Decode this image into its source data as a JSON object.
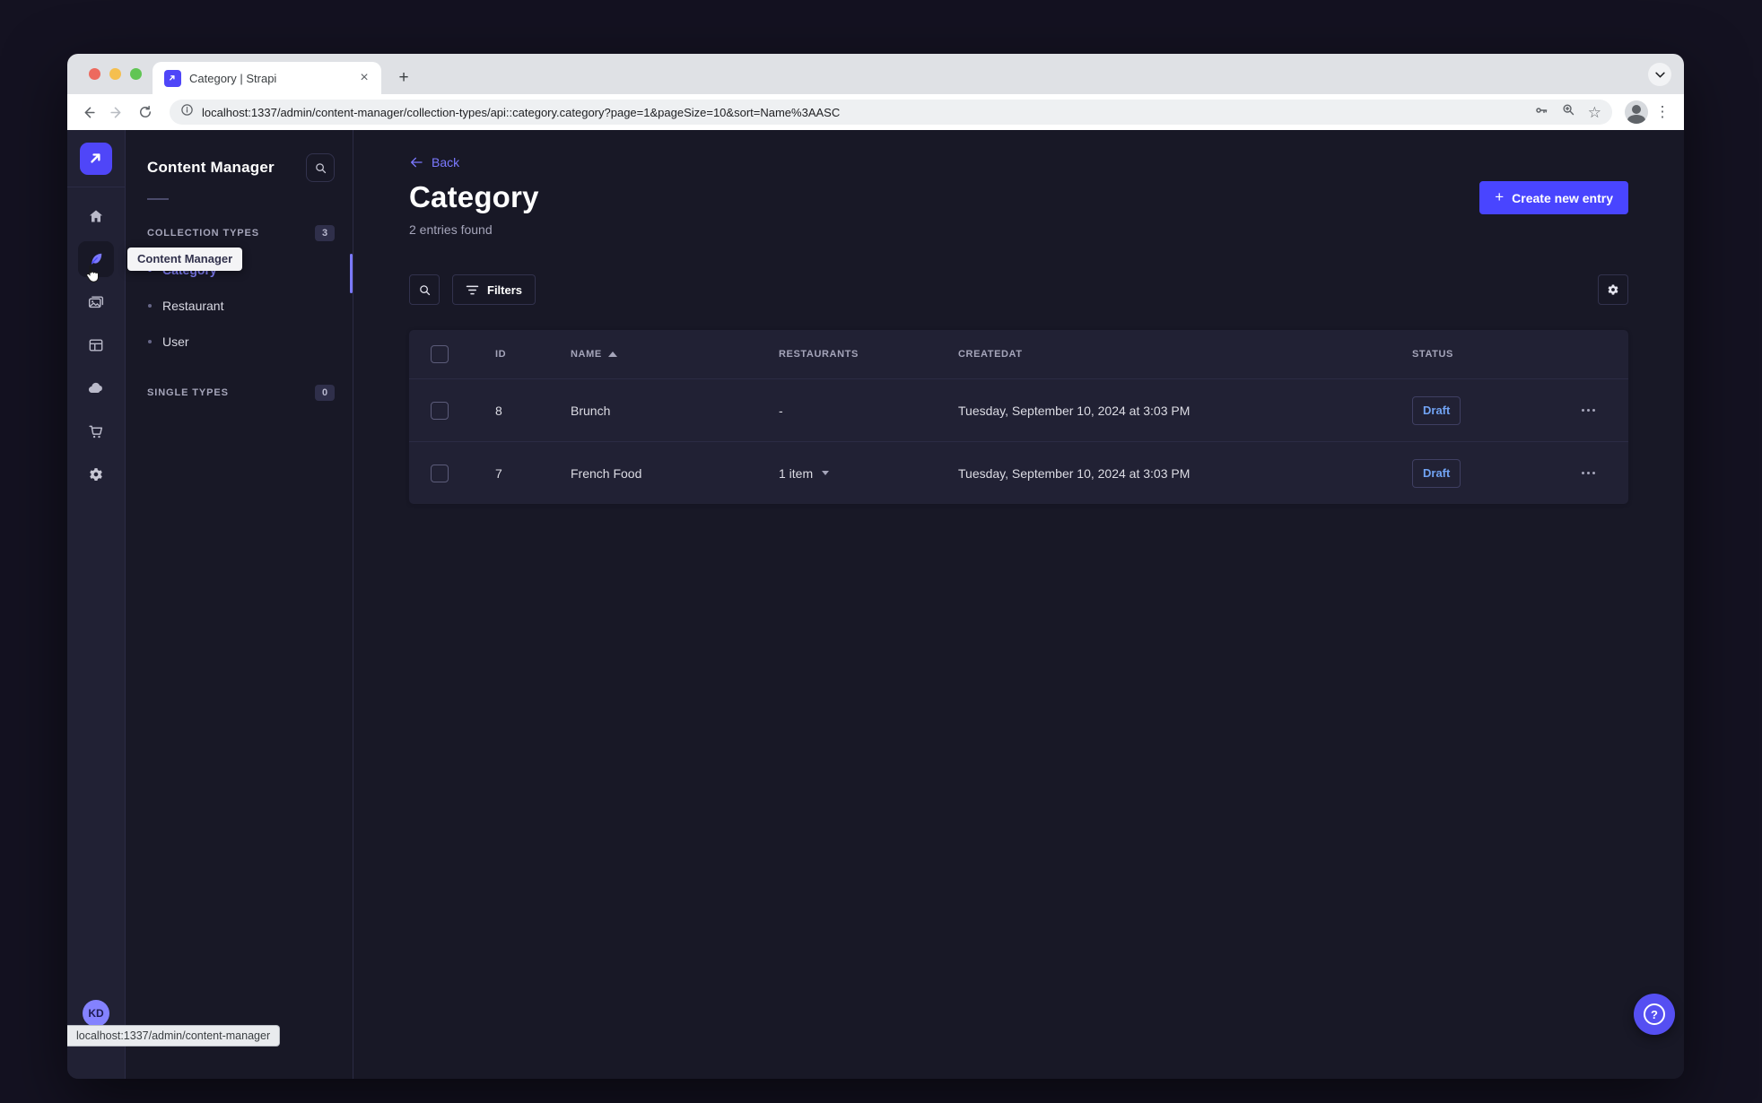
{
  "colors": {
    "primary": "#4945ff",
    "primary_light": "#7b79ff",
    "draft_text": "#71a3f3",
    "app_bg": "#181826",
    "panel_bg": "#212134"
  },
  "browser": {
    "tab_title": "Category | Strapi",
    "url": "localhost:1337/admin/content-manager/collection-types/api::category.category?page=1&pageSize=10&sort=Name%3AASC",
    "status_bar": "localhost:1337/admin/content-manager"
  },
  "nav": {
    "tooltip": "Content Manager",
    "avatar_initials": "KD"
  },
  "subnav": {
    "title": "Content Manager",
    "collection_types": {
      "label": "COLLECTION TYPES",
      "badge": "3",
      "items": [
        {
          "label": "Category",
          "active": true
        },
        {
          "label": "Restaurant",
          "active": false
        },
        {
          "label": "User",
          "active": false
        }
      ]
    },
    "single_types": {
      "label": "SINGLE TYPES",
      "badge": "0"
    }
  },
  "main": {
    "back_label": "Back",
    "title": "Category",
    "subtitle": "2 entries found",
    "create_button": "Create new entry",
    "filters_label": "Filters",
    "table": {
      "headers": {
        "id": "ID",
        "name": "NAME",
        "restaurants": "RESTAURANTS",
        "createdat": "CREATEDAT",
        "status": "STATUS"
      },
      "rows": [
        {
          "id": "8",
          "name": "Brunch",
          "restaurants": "-",
          "createdat": "Tuesday, September 10, 2024 at 3:03 PM",
          "status": "Draft"
        },
        {
          "id": "7",
          "name": "French Food",
          "restaurants": "1 item",
          "createdat": "Tuesday, September 10, 2024 at 3:03 PM",
          "status": "Draft"
        }
      ]
    }
  },
  "icons": {
    "plus": "+",
    "close": "×",
    "help": "?",
    "star": "☆",
    "menu_dots": "⋮"
  }
}
